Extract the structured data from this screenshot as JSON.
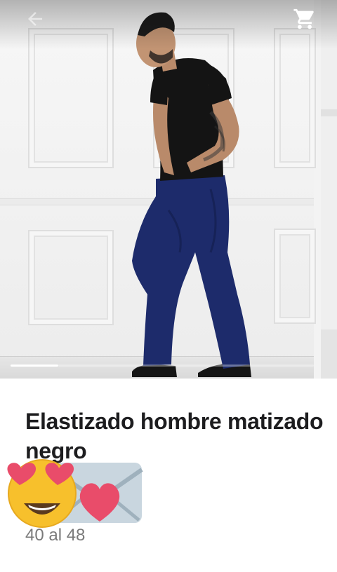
{
  "header": {
    "back_icon": "arrow-left-icon",
    "cart_icon": "shopping-cart-icon"
  },
  "gallery": {
    "image_count": 2,
    "current_index": 1
  },
  "product": {
    "title": "Elastizado hombre matizado negro",
    "size_range": "40 al 48"
  },
  "stickers": {
    "items": [
      "heart-eyes-face-emoji",
      "envelope-with-heart-emoji"
    ]
  },
  "colors": {
    "title": "#1d1d1f",
    "secondary_text": "#7a7a7a",
    "heart": "#e94c6a",
    "jeans": "#1d2b6b",
    "shirt": "#141414"
  }
}
